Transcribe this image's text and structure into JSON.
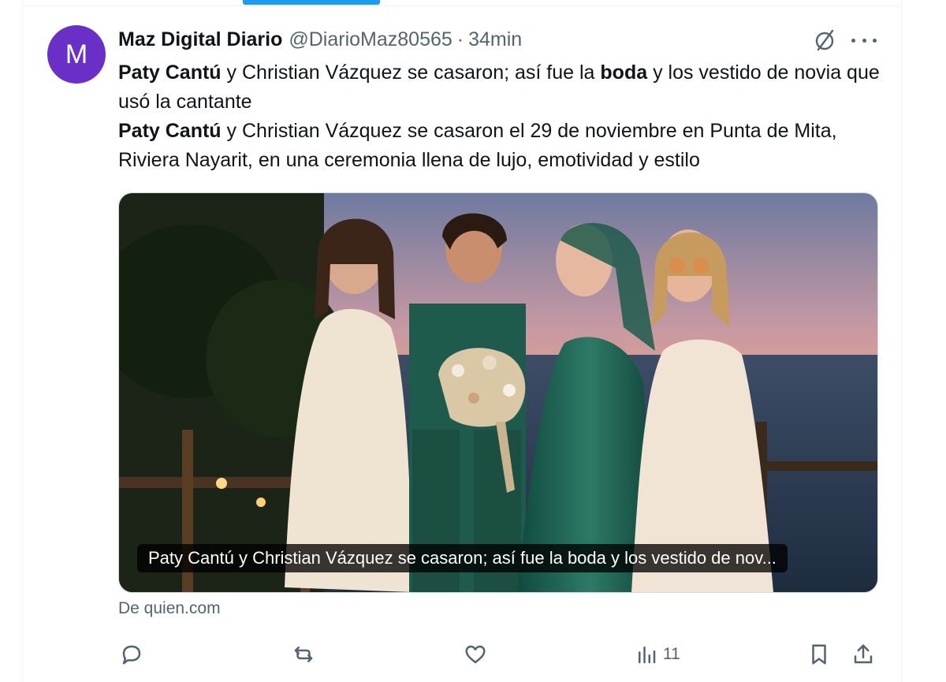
{
  "tweet": {
    "avatar_letter": "M",
    "author_name": "Maz Digital Diario",
    "handle": "@DiarioMaz80565",
    "separator": "·",
    "time": "34min",
    "text_line1_bold": "Paty Cantú",
    "text_line1_a": " y Christian Vázquez se casaron; así fue la ",
    "text_line1_bold2": "boda",
    "text_line1_b": " y los vestido de novia que usó la cantante",
    "text_line2_bold": "Paty Cantú",
    "text_line2_rest": " y Christian Vázquez se casaron el 29 de noviembre en Punta de Mita, Riviera Nayarit, en una ceremonia llena de lujo, emotividad y estilo",
    "media_caption": "Paty Cantú y Christian Vázquez se casaron; así fue la boda y los vestido de nov...",
    "source": "De quien.com"
  },
  "actions": {
    "views_count": "11"
  },
  "icons": {
    "grok": "grok-slash-circle-icon",
    "more": "more-dots-icon",
    "reply": "reply-icon",
    "retweet": "retweet-icon",
    "like": "heart-icon",
    "views": "views-bar-chart-icon",
    "bookmark": "bookmark-icon",
    "share": "share-icon"
  },
  "colors": {
    "accent": "#1d9bf0",
    "avatar_bg": "#6a2fc7",
    "secondary_text": "#536471"
  }
}
